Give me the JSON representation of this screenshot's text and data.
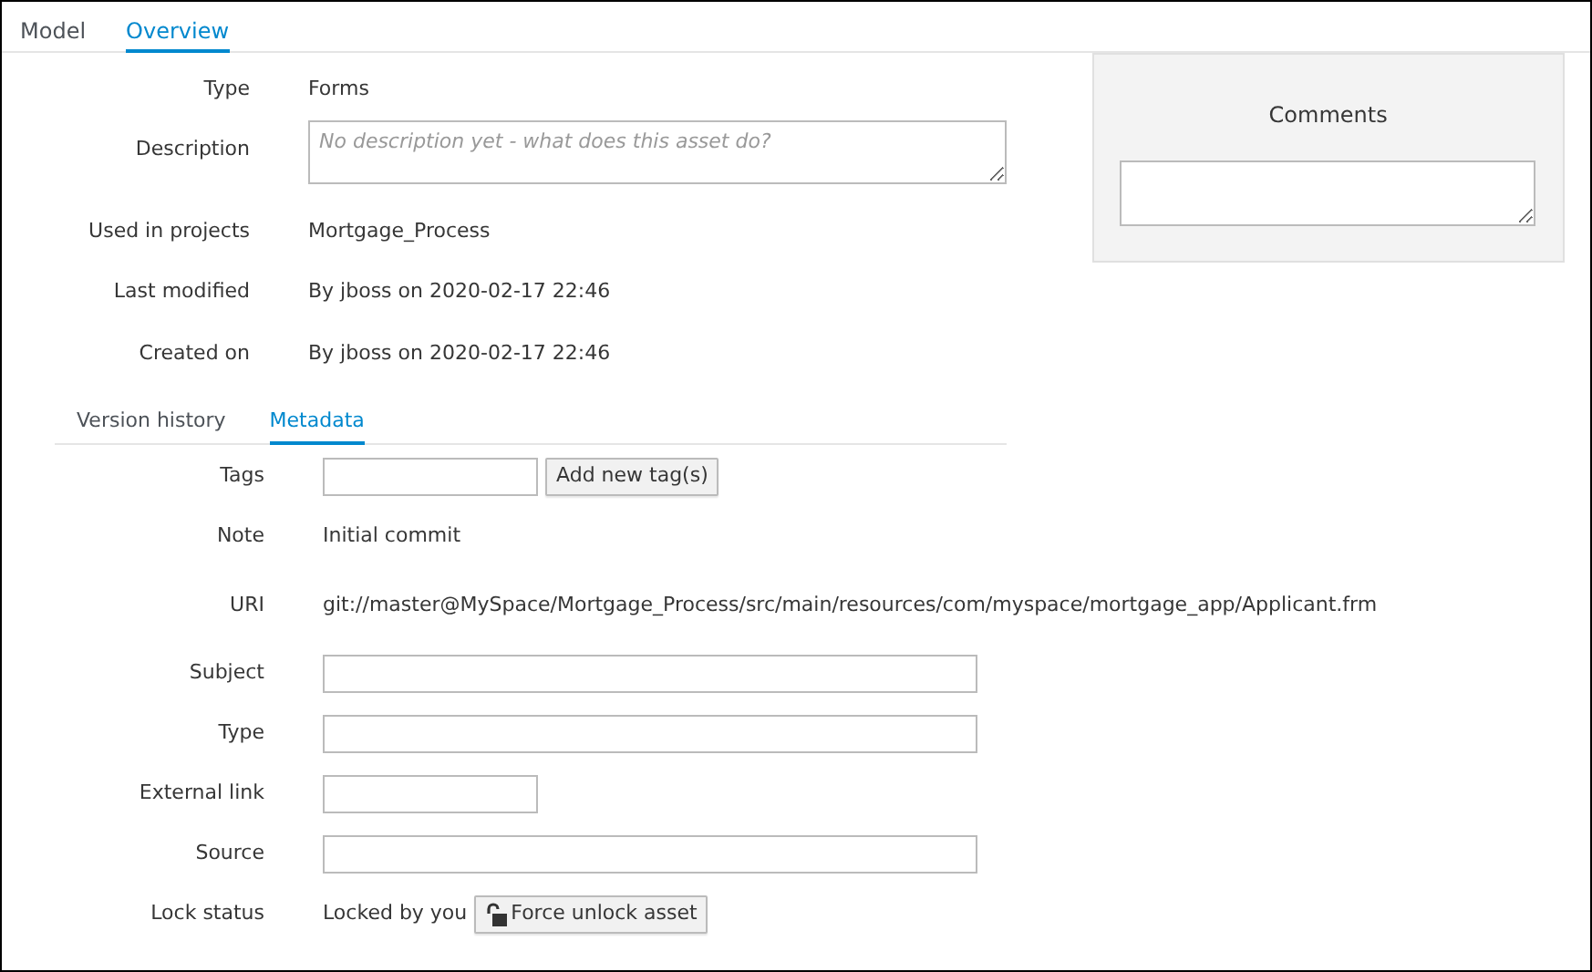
{
  "tabs": [
    {
      "label": "Model",
      "selected": false
    },
    {
      "label": "Overview",
      "selected": true
    }
  ],
  "overview": {
    "rows": [
      {
        "label": "Type",
        "kind": "text",
        "value": "Forms"
      },
      {
        "label": "Description",
        "kind": "textarea",
        "placeholder": "No description yet - what does this asset do?"
      },
      {
        "label": "Used in projects",
        "kind": "text",
        "value": "Mortgage_Process"
      },
      {
        "label": "Last modified",
        "kind": "text",
        "value": "By jboss on 2020-02-17 22:46"
      },
      {
        "label": "Created on",
        "kind": "text",
        "value": "By jboss on 2020-02-17 22:46"
      }
    ]
  },
  "comments": {
    "title": "Comments"
  },
  "subtabs": [
    {
      "label": "Version history",
      "selected": false
    },
    {
      "label": "Metadata",
      "selected": true
    }
  ],
  "metadata": {
    "rows": [
      {
        "label": "Tags",
        "kind": "tags",
        "button": "Add new tag(s)"
      },
      {
        "label": "Note",
        "kind": "text",
        "value": "Initial commit"
      },
      {
        "label": "URI",
        "kind": "text",
        "value": "git://master@MySpace/Mortgage_Process/src/main/resources/com/myspace/mortgage_app/Applicant.frm"
      },
      {
        "label": "Subject",
        "kind": "field"
      },
      {
        "label": "Type",
        "kind": "field"
      },
      {
        "label": "External link",
        "kind": "short_field"
      },
      {
        "label": "Source",
        "kind": "field"
      },
      {
        "label": "Lock status",
        "kind": "lock",
        "value": "Locked by you",
        "button": "Force unlock asset"
      }
    ]
  }
}
